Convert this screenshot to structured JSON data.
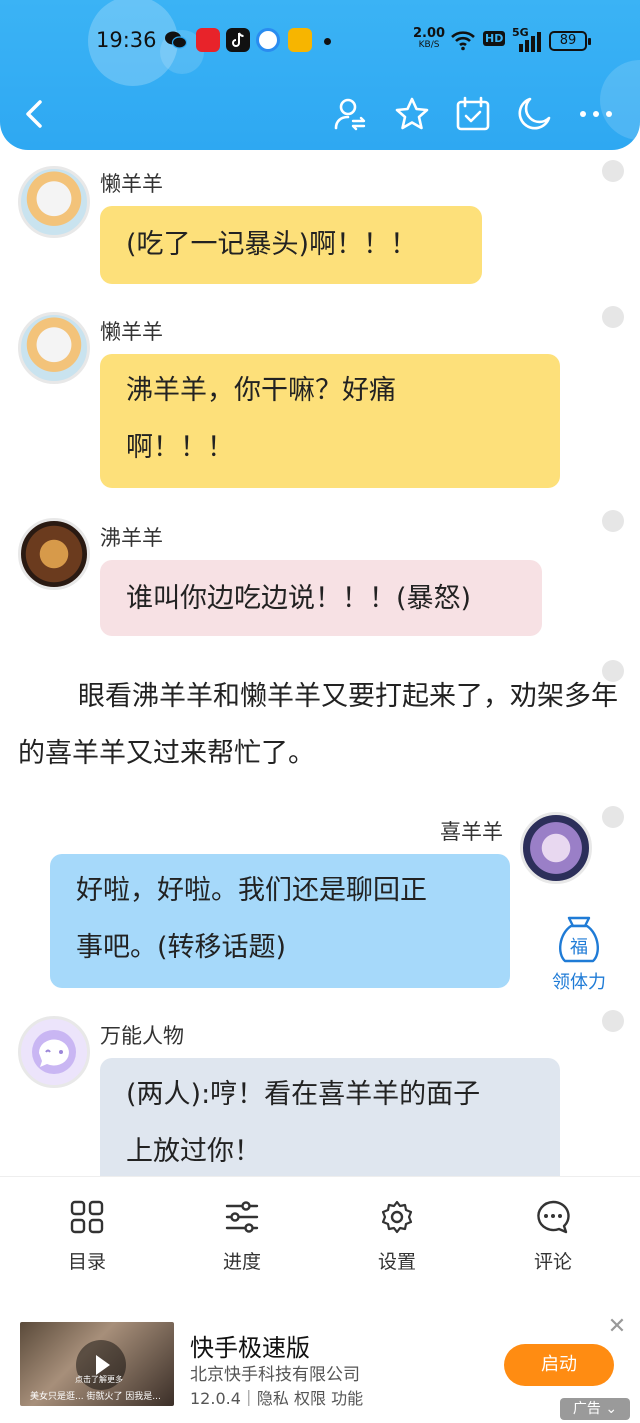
{
  "status_bar": {
    "time": "19:36",
    "net_speed": "2.00",
    "net_speed_unit": "KB/S",
    "hd": "HD",
    "network": "5G",
    "battery": "89"
  },
  "toolbar": {
    "icons": [
      "back-icon",
      "switch-role-icon",
      "star-icon",
      "calendar-check-icon",
      "moon-icon",
      "more-icon"
    ]
  },
  "chat": {
    "messages": [
      {
        "name": "懒羊羊",
        "text": "(吃了一记暴头)啊！！！"
      },
      {
        "name": "懒羊羊",
        "text_line1": "沸羊羊，你干嘛？好痛",
        "text_line2": "啊！！！"
      },
      {
        "name": "沸羊羊",
        "text": "谁叫你边吃边说！！！(暴怒)"
      },
      {
        "name": "喜羊羊",
        "text_line1": "好啦，好啦。我们还是聊回正",
        "text_line2": "事吧。(转移话题)"
      },
      {
        "name": "万能人物",
        "text_line1": "(两人):哼！看在喜羊羊的面子",
        "text_line2": "上放过你！"
      }
    ],
    "narration": "眼看沸羊羊和懒羊羊又要打起来了，劝架多年的喜羊羊又过来帮忙了。",
    "fortune": {
      "icon_char": "福",
      "label": "领体力"
    }
  },
  "bottom_nav": {
    "items": [
      {
        "label": "目录",
        "icon": "grid-icon"
      },
      {
        "label": "进度",
        "icon": "sliders-icon"
      },
      {
        "label": "设置",
        "icon": "gear-icon"
      },
      {
        "label": "评论",
        "icon": "comment-icon"
      }
    ]
  },
  "ad": {
    "title": "快手极速版",
    "company": "北京快手科技有限公司",
    "meta": "12.0.4｜隐私  权限  功能",
    "thumb_text": "美女只是逛... 街就火了 因我是...",
    "thumb_overlay": "点击了解更多",
    "button": "启动",
    "tag": "广告",
    "colors": {
      "button": "#ff8c12"
    }
  },
  "colors": {
    "header": "#2ea8f2",
    "yellow_bubble": "#fde07a",
    "pink_bubble": "#f7e1e4",
    "blue_bubble": "#a6d9fa",
    "gray_bubble": "#dfe6ef"
  }
}
